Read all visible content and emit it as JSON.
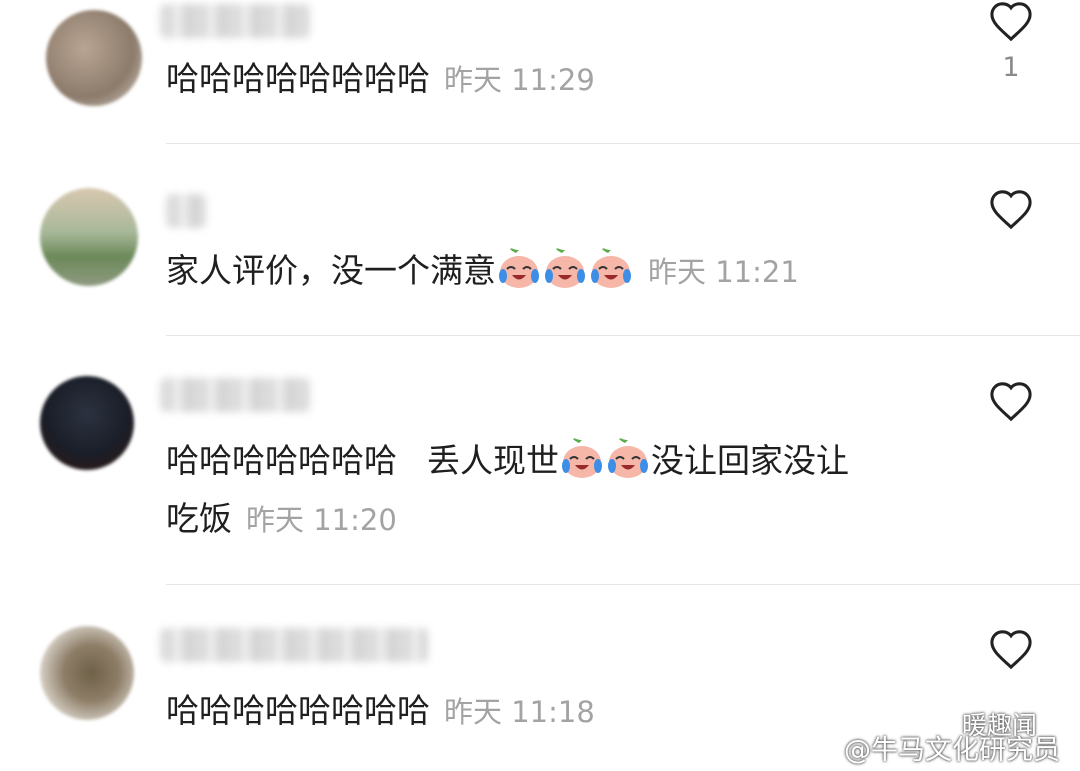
{
  "comments": [
    {
      "text": "哈哈哈哈哈哈哈哈",
      "time": "昨天 11:29",
      "likes": "1",
      "emoji_count": 0
    },
    {
      "text": "家人评价，没一个满意",
      "time": "昨天 11:21",
      "likes": "",
      "emoji_count": 3
    },
    {
      "text_a": "哈哈哈哈哈哈哈",
      "text_b": "丢人现世",
      "text_c": "没让回家没让",
      "text_line2": "吃饭",
      "time": "昨天 11:20",
      "likes": "",
      "emoji_count": 2
    },
    {
      "text": "哈哈哈哈哈哈哈哈",
      "time": "昨天 11:18",
      "likes": ""
    }
  ],
  "watermarks": {
    "wechat": "暖趣闻",
    "weibo": "@牛马文化研究员"
  },
  "icons": {
    "like": "heart-outline-icon",
    "emoji": "crying-laughing-emoji",
    "wechat": "wechat-icon",
    "weibo": "weibo-icon"
  }
}
